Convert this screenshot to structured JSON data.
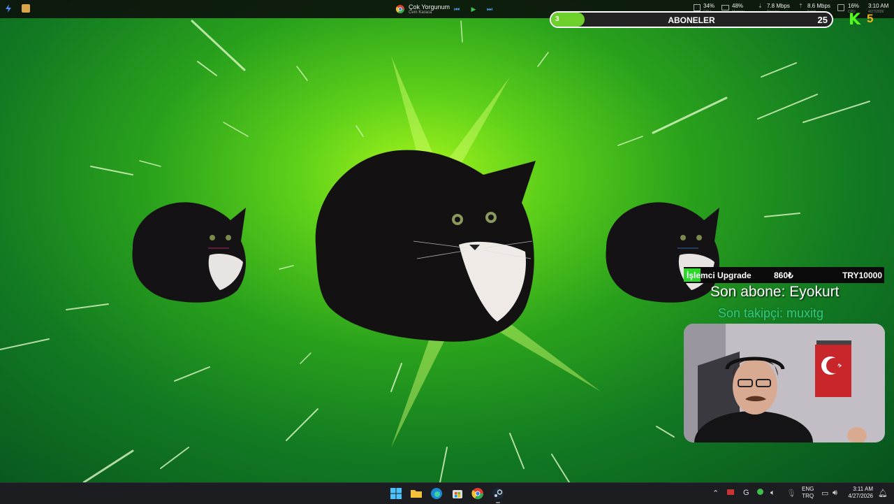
{
  "topbar": {
    "media": {
      "song": "Çok Yorgunum",
      "artist": "Cem Karaca"
    },
    "stats": [
      {
        "value": "34%",
        "label": "GPU"
      },
      {
        "value": "48%",
        "label": "Memory"
      },
      {
        "value": "7.8 Mbps",
        "label": "Receive"
      },
      {
        "value": "8.6 Mbps",
        "label": "Send"
      },
      {
        "value": "16%",
        "label": "CPU"
      }
    ],
    "time": "3:10 AM",
    "date": "4/27/2026"
  },
  "subs": {
    "current": "3",
    "title": "ABONELER",
    "goal": "25",
    "progress": 0.12
  },
  "kick": {
    "logo": "K",
    "count": "5"
  },
  "ticker": {
    "item": "İşlemci Upgrade",
    "amount": "860₺",
    "goal": "TRY10000"
  },
  "overlay": {
    "last_sub": "Son abone: Eyokurt",
    "last_follow": "Son takipçi: muxitg"
  },
  "taskbar": {
    "apps": [
      "windows-icon",
      "file-explorer-icon",
      "edge-icon",
      "store-icon",
      "chrome-icon",
      "steam-icon"
    ],
    "lang": "ENG",
    "region": "TRQ",
    "time": "3:11 AM",
    "date": "4/27/2026"
  },
  "colors": {
    "accent": "#6ed02a",
    "kick": "#53fc18",
    "bg_green": "#2aa21c"
  }
}
